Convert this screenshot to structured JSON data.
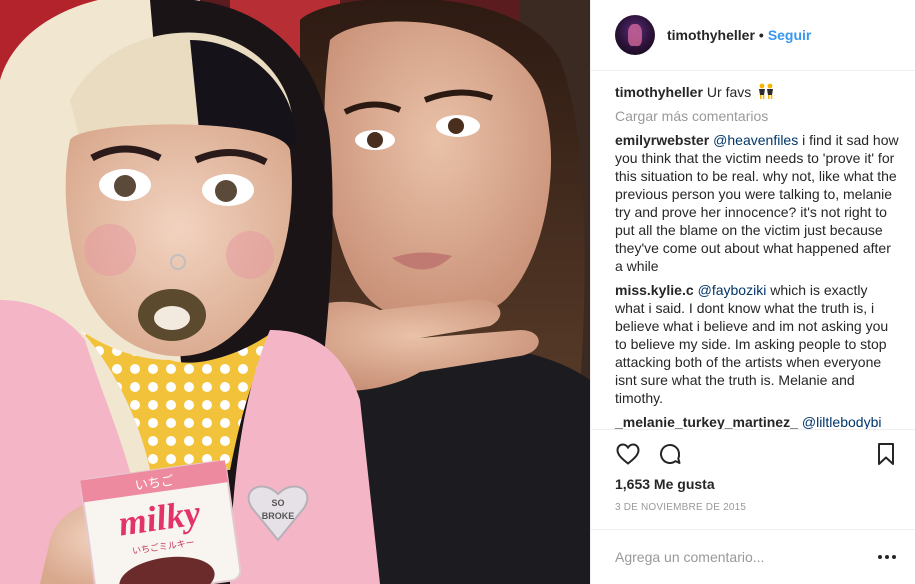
{
  "header": {
    "username": "timothyheller",
    "separator": "•",
    "follow_label": "Seguir"
  },
  "caption": {
    "username": "timothyheller",
    "text": "Ur favs",
    "emoji": "dancers-emoji"
  },
  "load_more_label": "Cargar más comentarios",
  "comments": [
    {
      "username": "emilyrwebster",
      "mention": "@heavenfiles",
      "text": "i find it sad how you think that the victim needs to 'prove it' for this situation to be real. why not, like what the previous person you were talking to, melanie try and prove her innocence? it's not right to put all the blame on the victim just because they've come out about what happened after a while"
    },
    {
      "username": "miss.kylie.c",
      "mention": "@fayboziki",
      "text": "which is exactly what i said. I dont know what the truth is, i believe what i believe and im not asking you to believe my side. Im asking people to stop attacking both of the artists when everyone isnt sure what the truth is. Melanie and timothy."
    },
    {
      "username": "_melanie_turkey_martinez_",
      "mention": "@liltlebodybi",
      "text": ""
    }
  ],
  "actions": {
    "like_icon": "heart-icon",
    "comment_icon": "comment-bubble-icon",
    "save_icon": "bookmark-icon"
  },
  "likes_text": "1,653 Me gusta",
  "date_text": "3 DE NOVIEMBRE DE 2015",
  "add_comment": {
    "placeholder": "Agrega un comentario...",
    "more_icon": "ellipsis-icon"
  },
  "photo": {
    "packaging_text_top": "いちご",
    "packaging_text_main": "milky",
    "packaging_text_bottom": "いちごミルキー",
    "pin_text_line1": "SO",
    "pin_text_line2": "BROKE"
  },
  "colors": {
    "link_blue": "#3897f0",
    "mention_navy": "#003569",
    "muted_gray": "#999999",
    "text_dark": "#262626",
    "border": "#efefef"
  }
}
